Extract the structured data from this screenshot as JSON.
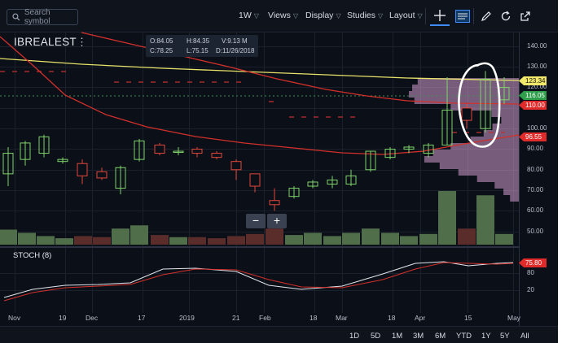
{
  "toolbar": {
    "search_placeholder": "Search symbol",
    "interval_label": "1W",
    "views_label": "Views",
    "display_label": "Display",
    "studies_label": "Studies",
    "layout_label": "Layout"
  },
  "symbol": {
    "name": "IBREALEST",
    "menu_glyph": "⋮"
  },
  "ohlc": {
    "open": "O:84.05",
    "high": "H:84.35",
    "volume": "V:9.13 M",
    "close": "C:78.25",
    "low": "L:75.15",
    "date": "D:11/26/2018"
  },
  "price_axis": [
    "140.00",
    "130.00",
    "120.00",
    "110.00",
    "100.00",
    "90.00",
    "80.00",
    "70.00",
    "60.00",
    "50.00"
  ],
  "price_tags": [
    {
      "text": "123.34",
      "color": "#f2e96b",
      "text_color": "#111111"
    },
    {
      "text": "116.05",
      "color": "#2e9e4a",
      "text_color": "#ffffff"
    },
    {
      "text": "110.00",
      "color": "#e02b2b",
      "text_color": "#ffffff"
    },
    {
      "text": "96.55",
      "color": "#e02b2b",
      "text_color": "#ffffff"
    }
  ],
  "stoch": {
    "title": "STOCH (8)",
    "axis": [
      "80",
      "20"
    ],
    "tag": "75.80"
  },
  "x_axis": [
    "Nov",
    "19",
    "Dec",
    "17",
    "2019",
    "21",
    "Feb",
    "18",
    "Mar",
    "18",
    "Apr",
    "15",
    "May"
  ],
  "ranges": [
    "1D",
    "5D",
    "1M",
    "3M",
    "6M",
    "YTD",
    "1Y",
    "5Y",
    "All"
  ],
  "icons": {
    "search": "search-icon",
    "crosshair": "crosshair-icon",
    "news": "news-icon",
    "draw": "pencil-icon",
    "refresh": "refresh-icon",
    "popout": "popout-icon"
  },
  "colors": {
    "up": "#7fd36b",
    "down": "#e2473a",
    "ma_yellow": "#e9e36a",
    "ma_red": "#d3302b",
    "profile": "#e6a9e0",
    "annotation": "#ffffff"
  }
}
